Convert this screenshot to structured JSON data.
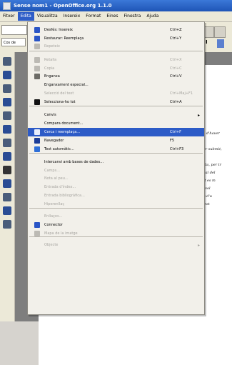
{
  "window": {
    "title": "Sense nom1 - OpenOffice.org 1.1.0"
  },
  "menubar": [
    "Fitxer",
    "Edita",
    "Visualitza",
    "Insereix",
    "Format",
    "Eines",
    "Finestra",
    "Ajuda"
  ],
  "toolbar": {
    "style_box": "Cos de"
  },
  "menu": {
    "items": [
      {
        "label": "Desfés: Insereix",
        "shortcut": "Ctrl+Z",
        "disabled": false,
        "icon": "undo-icon",
        "color": "#2a55c6"
      },
      {
        "label": "Restaurar: Reemplaça",
        "shortcut": "Ctrl+Y",
        "disabled": false,
        "icon": "redo-icon",
        "color": "#2a55c6"
      },
      {
        "label": "Repeteix",
        "shortcut": "",
        "disabled": true,
        "icon": "repeat-icon",
        "color": "#bcbab4"
      },
      {
        "label": "Retalla",
        "shortcut": "Ctrl+X",
        "disabled": true,
        "icon": "cut-icon",
        "color": "#bcbab4"
      },
      {
        "label": "Copia",
        "shortcut": "Ctrl+C",
        "disabled": true,
        "icon": "copy-icon",
        "color": "#bcbab4"
      },
      {
        "label": "Enganxa",
        "shortcut": "Ctrl+V",
        "disabled": false,
        "icon": "paste-icon",
        "color": "#6c6b66"
      },
      {
        "label": "Enganxament especial...",
        "shortcut": "",
        "disabled": false,
        "icon": "",
        "color": ""
      },
      {
        "label": "Selecció del text",
        "shortcut": "Ctrl+Maj+F1",
        "disabled": true,
        "icon": "",
        "color": ""
      },
      {
        "label": "Selecciona-ho tot",
        "shortcut": "Ctrl+A",
        "disabled": false,
        "icon": "select-all-icon",
        "color": "#111"
      },
      {
        "label": "Canvis",
        "shortcut": "",
        "disabled": false,
        "icon": "",
        "color": "",
        "submenu": true
      },
      {
        "label": "Compara document...",
        "shortcut": "",
        "disabled": false,
        "icon": "",
        "color": ""
      },
      {
        "label": "Cerca i reemplaça...",
        "shortcut": "Ctrl+F",
        "disabled": false,
        "icon": "binoculars-icon",
        "color": "#e8eefc",
        "highlight": true
      },
      {
        "label": "Navegador",
        "shortcut": "F5",
        "disabled": false,
        "icon": "navigator-icon",
        "color": "#1b3d99"
      },
      {
        "label": "Text automàtic...",
        "shortcut": "Ctrl+F3",
        "disabled": false,
        "icon": "autotext-icon",
        "color": "#2f6fd8"
      },
      {
        "label": "Intercanvi amb bases de dades...",
        "shortcut": "",
        "disabled": false,
        "icon": "",
        "color": ""
      },
      {
        "label": "Camps...",
        "shortcut": "",
        "disabled": true,
        "icon": "",
        "color": ""
      },
      {
        "label": "Nota al peu...",
        "shortcut": "",
        "disabled": true,
        "icon": "",
        "color": ""
      },
      {
        "label": "Entrada d'índex...",
        "shortcut": "",
        "disabled": true,
        "icon": "",
        "color": ""
      },
      {
        "label": "Entrada bibliogràfica...",
        "shortcut": "",
        "disabled": true,
        "icon": "",
        "color": ""
      },
      {
        "label": "Hiperenllaç",
        "shortcut": "",
        "disabled": true,
        "icon": "",
        "color": ""
      },
      {
        "label": "Enllaços...",
        "shortcut": "",
        "disabled": true,
        "icon": "",
        "color": ""
      },
      {
        "label": "Connector",
        "shortcut": "",
        "disabled": false,
        "icon": "plugin-icon",
        "color": "#2a55c6"
      },
      {
        "label": "Mapa de la imatge",
        "shortcut": "",
        "disabled": true,
        "icon": "image-map-icon",
        "color": "#bcbab4"
      },
      {
        "label": "Objecte",
        "shortcut": "",
        "disabled": true,
        "icon": "",
        "color": "",
        "submenu": true
      }
    ]
  },
  "document": {
    "lines": [
      "ot anys d'haver deixat",
      "rra nuar submit, pr",
      "n d'ajuda, per tr",
      "n e ritual del",
      "iniment es m",
      "exió al vol",
      "del cup d'u",
      "mig const"
    ]
  },
  "colors": {
    "highlight": "#2d5bc7",
    "titlebar": "#2f68cf",
    "menu_bg": "#f2f0ea"
  }
}
